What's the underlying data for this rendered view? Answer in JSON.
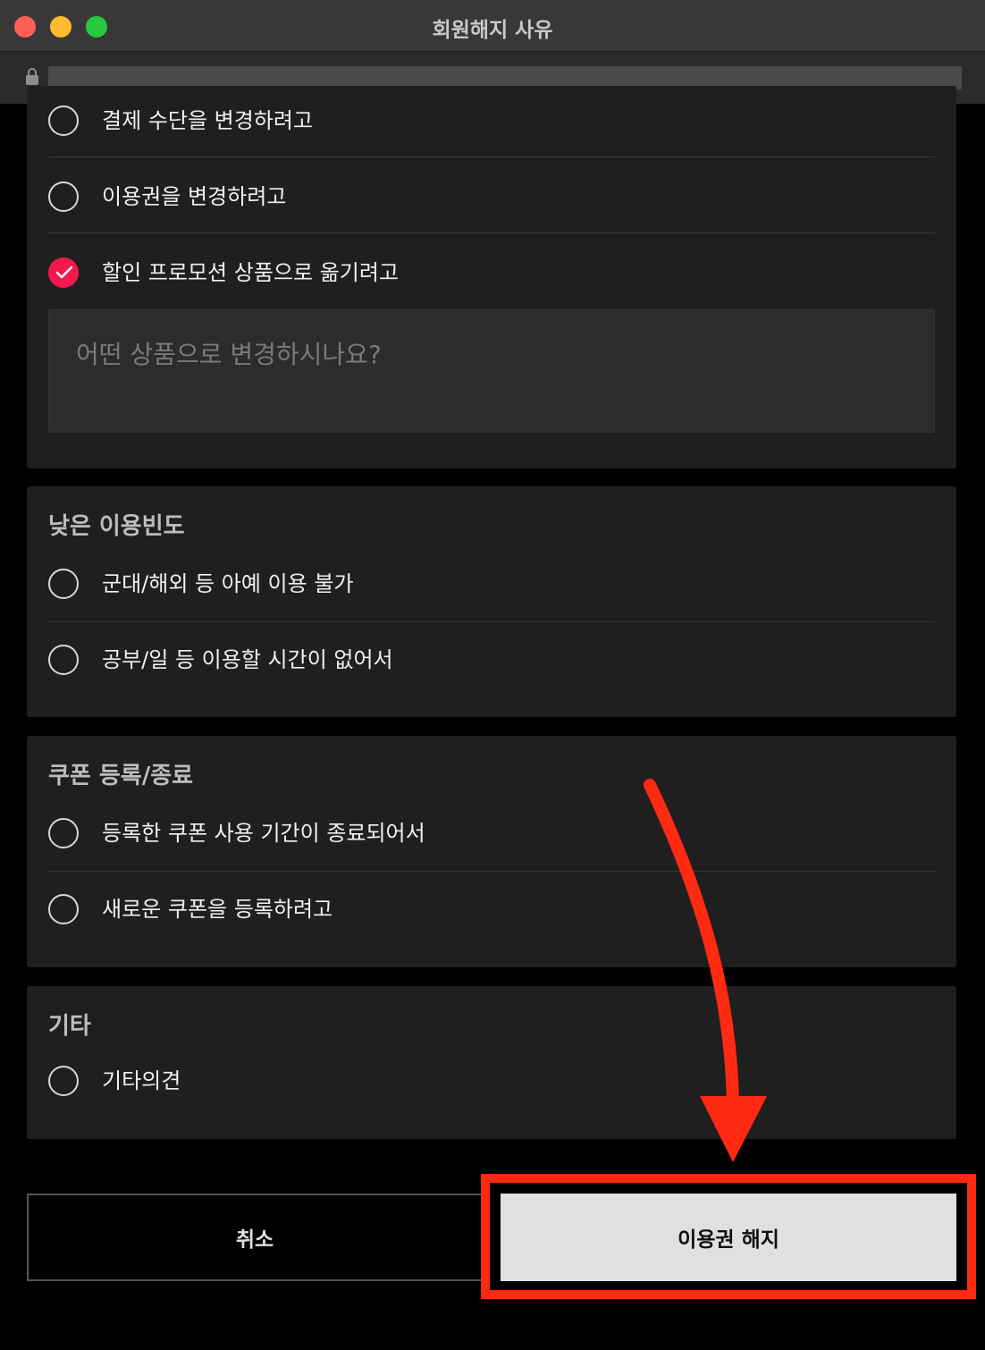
{
  "window": {
    "title": "회원해지 사유"
  },
  "sections": {
    "price": {
      "options": [
        {
          "label": "결제 수단을 변경하려고",
          "checked": false
        },
        {
          "label": "이용권을 변경하려고",
          "checked": false
        },
        {
          "label": "할인 프로모션 상품으로 옮기려고",
          "checked": true
        }
      ],
      "input_placeholder": "어떤 상품으로 변경하시나요?"
    },
    "low_usage": {
      "title": "낮은 이용빈도",
      "options": [
        {
          "label": "군대/해외 등 아예 이용 불가",
          "checked": false
        },
        {
          "label": "공부/일 등 이용할 시간이 없어서",
          "checked": false
        }
      ]
    },
    "coupon": {
      "title": "쿠폰 등록/종료",
      "options": [
        {
          "label": "등록한 쿠폰 사용 기간이 종료되어서",
          "checked": false
        },
        {
          "label": "새로운 쿠폰을 등록하려고",
          "checked": false
        }
      ]
    },
    "other": {
      "title": "기타",
      "options": [
        {
          "label": "기타의견",
          "checked": false
        }
      ]
    }
  },
  "buttons": {
    "cancel": "취소",
    "confirm": "이용권 해지"
  },
  "colors": {
    "accent": "#f5174d",
    "highlight": "#ff2a12",
    "card_bg": "#1f1f1f"
  }
}
